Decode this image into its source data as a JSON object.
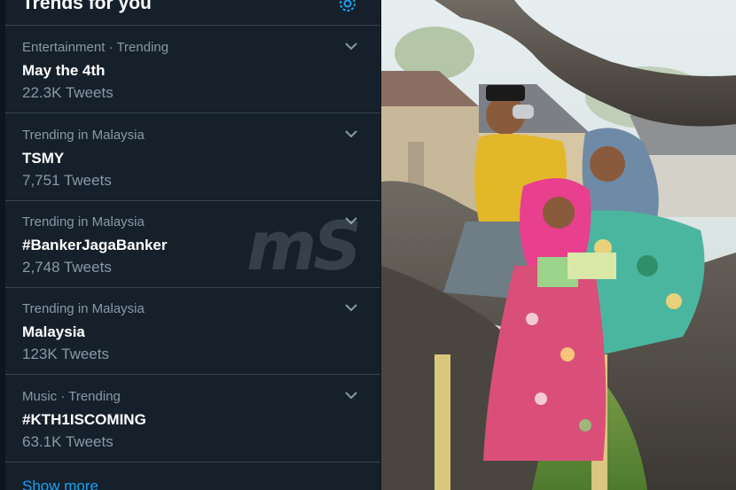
{
  "panel": {
    "title": "Trends for you",
    "icons": {
      "settings": "gear-icon",
      "expand": "chevron-down-icon"
    }
  },
  "trends": [
    {
      "context": "Entertainment · Trending",
      "name": "May the 4th",
      "count": "22.3K Tweets"
    },
    {
      "context": "Trending in Malaysia",
      "name": "TSMY",
      "count": "7,751 Tweets"
    },
    {
      "context": "Trending in Malaysia",
      "name": "#BankerJagaBanker",
      "count": "2,748 Tweets"
    },
    {
      "context": "Trending in Malaysia",
      "name": "Malaysia",
      "count": "123K Tweets"
    },
    {
      "context": "Music · Trending",
      "name": "#KTH1ISCOMING",
      "count": "63.1K Tweets"
    }
  ],
  "show_more": "Show more",
  "watermark": "mS",
  "colors": {
    "background": "#15202b",
    "divider": "#38444d",
    "secondary_text": "#8899a6",
    "accent": "#1da1f2"
  }
}
